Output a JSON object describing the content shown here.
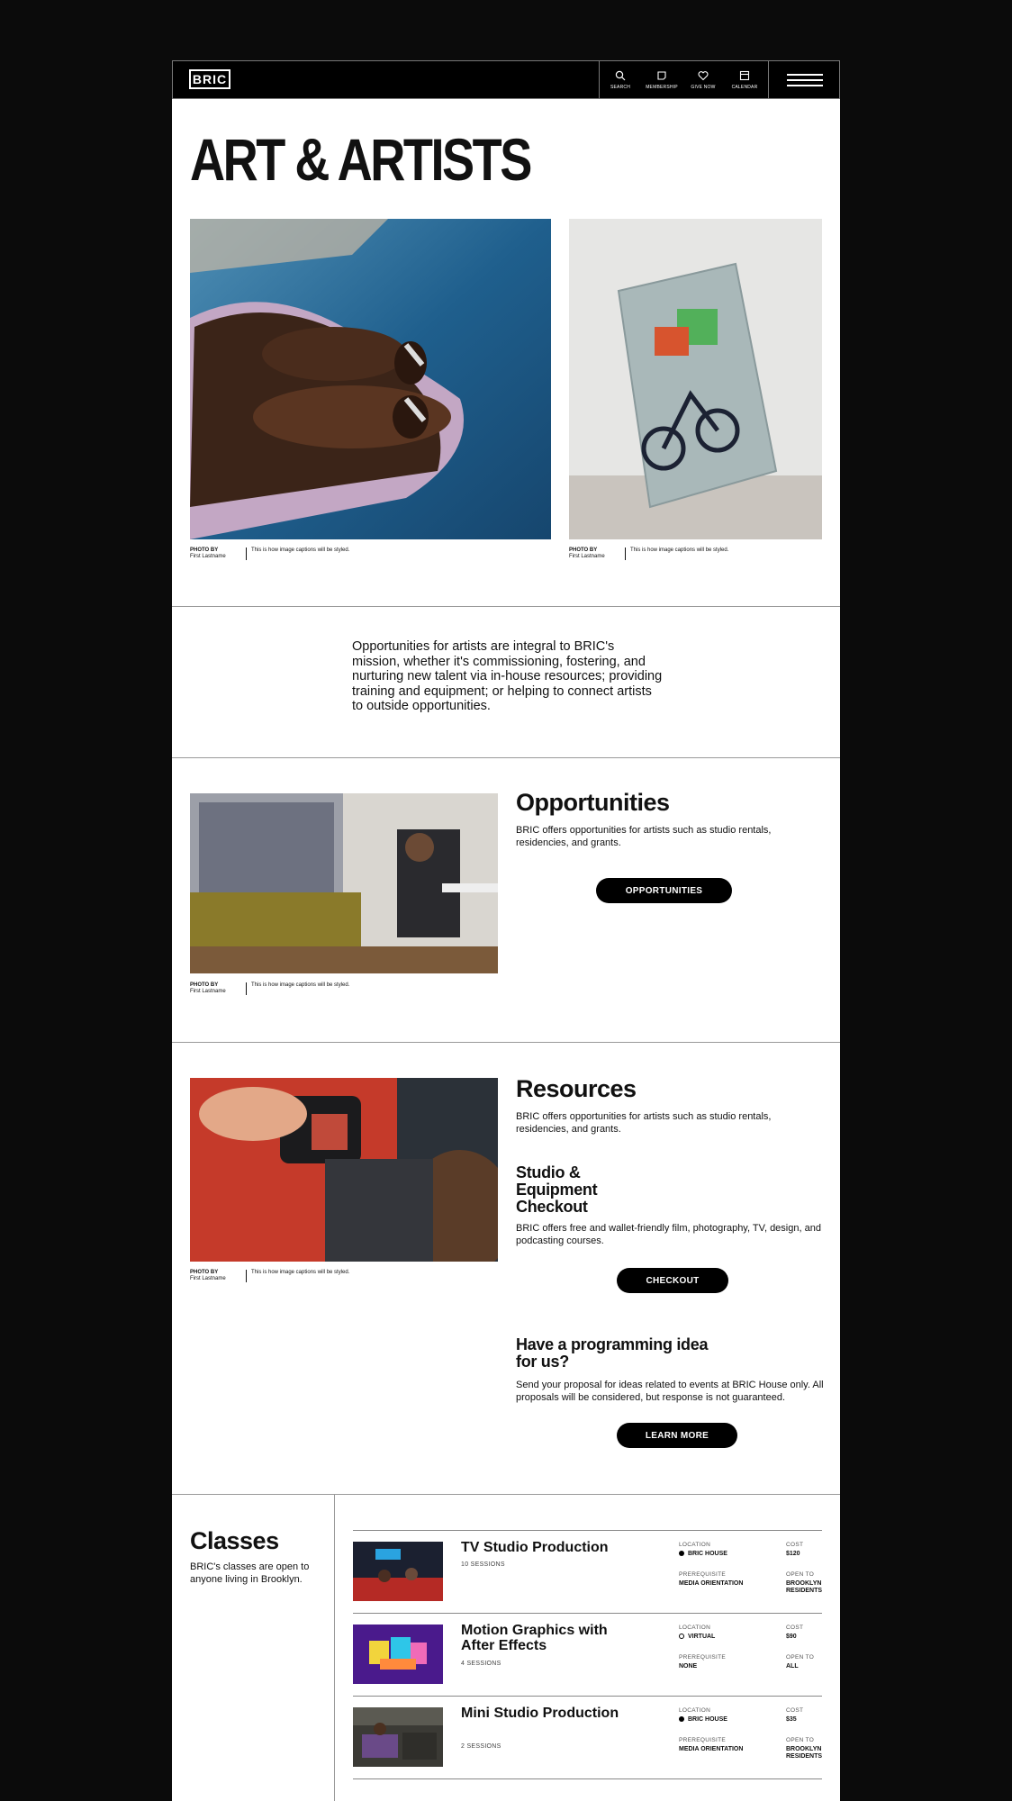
{
  "header": {
    "logo": "BRIC",
    "nav": [
      {
        "label": "SEARCH",
        "icon": "search-icon"
      },
      {
        "label": "MEMBERSHIP",
        "icon": "membership-icon"
      },
      {
        "label": "GIVE NOW",
        "icon": "heart-icon"
      },
      {
        "label": "CALENDAR",
        "icon": "calendar-icon"
      }
    ],
    "menu_icon": "hamburger-menu-icon"
  },
  "page_title": "ART & ARTISTS",
  "captions": {
    "photo_by": "PHOTO BY",
    "name": "First Lastname",
    "text": "This is how image captions will be styled."
  },
  "intro": "Opportunities for artists are integral to BRIC's mission, whether it's commissioning, fostering, and nurturing new talent via in-house resources; providing training and equipment; or helping to connect artists to outside opportunities.",
  "opportunities": {
    "title": "Opportunities",
    "body": "BRIC offers opportunities for artists such as studio rentals, residencies, and grants.",
    "button": "OPPORTUNITIES"
  },
  "resources": {
    "title": "Resources",
    "body": "BRIC offers opportunities for artists such as studio rentals, residencies, and grants.",
    "studio_title": "Studio & Equipment Checkout",
    "studio_body": "BRIC offers free and wallet-friendly film, photography, TV, design, and podcasting courses.",
    "studio_button": "CHECKOUT",
    "idea_title": "Have a programming idea for us?",
    "idea_body": "Send your proposal for ideas related to events at BRIC House only. All proposals will be considered, but response is not guaranteed.",
    "idea_button": "LEARN MORE"
  },
  "classes": {
    "title": "Classes",
    "body": "BRIC's classes are open to anyone living in Brooklyn.",
    "labels": {
      "location": "LOCATION",
      "cost": "COST",
      "prerequisite": "PREREQUISITE",
      "open_to": "OPEN TO"
    },
    "items": [
      {
        "name": "TV Studio Production",
        "sessions": "10 SESSIONS",
        "location": "BRIC HOUSE",
        "cost": "$120",
        "prerequisite": "MEDIA ORIENTATION",
        "open_to": "BROOKLYN RESIDENTS",
        "location_type": "in-person"
      },
      {
        "name": "Motion Graphics with After Effects",
        "sessions": "4 SESSIONS",
        "location": "VIRTUAL",
        "cost": "$90",
        "prerequisite": "NONE",
        "open_to": "ALL",
        "location_type": "virtual"
      },
      {
        "name": "Mini Studio Production",
        "sessions": "2 SESSIONS",
        "location": "BRIC HOUSE",
        "cost": "$35",
        "prerequisite": "MEDIA ORIENTATION",
        "open_to": "BROOKLYN RESIDENTS",
        "location_type": "in-person"
      }
    ]
  }
}
